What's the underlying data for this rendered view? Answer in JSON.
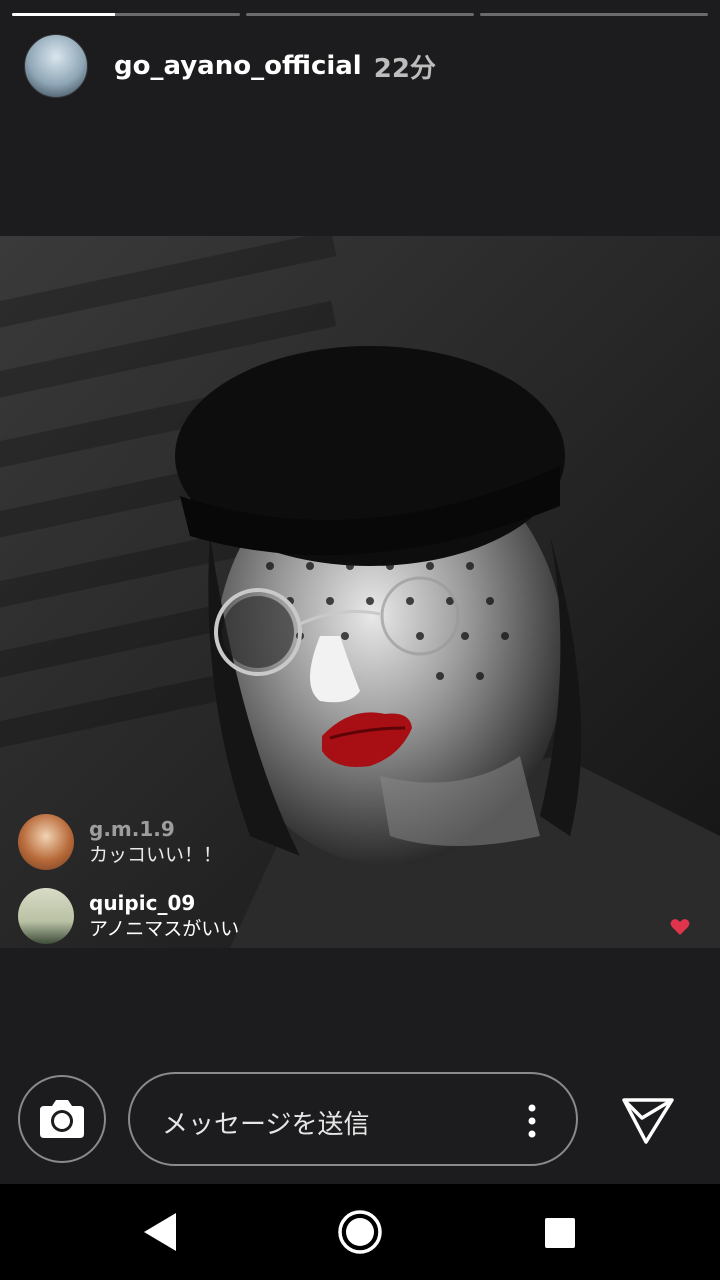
{
  "story": {
    "progress": [
      0.45,
      0,
      0
    ],
    "username": "go_ayano_official",
    "time": "22分"
  },
  "comments": [
    {
      "user": "g.m.1.9",
      "message": "カッコいい！！"
    },
    {
      "user": "quipic_09",
      "message": "アノニマスがいい"
    }
  ],
  "composer": {
    "placeholder": "メッセージを送信"
  },
  "icons": {
    "camera": "camera-icon",
    "more": "more-vertical-icon",
    "send": "send-icon",
    "heart": "heart-icon",
    "back": "back-triangle-icon",
    "home": "home-circle-icon",
    "recent": "recent-apps-square-icon"
  },
  "colors": {
    "background": "#1c1c1e",
    "lips": "#a80f14",
    "heart": "#e0344c"
  }
}
